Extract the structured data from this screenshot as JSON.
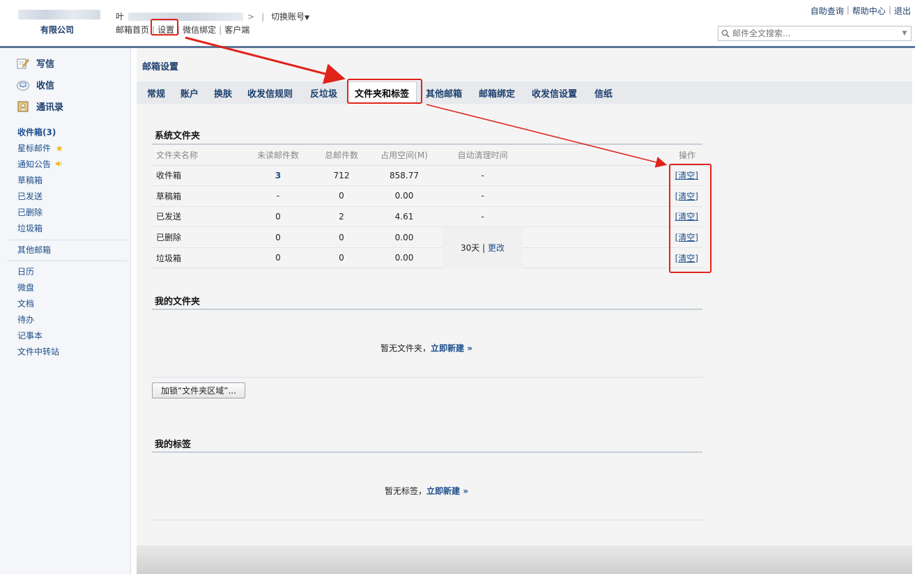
{
  "header": {
    "company": "有限公司",
    "account_prefix": "叶",
    "switch_account": "切换账号",
    "nav": [
      "邮箱首页",
      "设置",
      "微信绑定",
      "客户端"
    ],
    "top_links": [
      "自助查询",
      "帮助中心",
      "退出"
    ],
    "search_placeholder": "邮件全文搜索..."
  },
  "sidebar": {
    "compose": "写信",
    "receive": "收信",
    "contacts": "通讯录",
    "folders": [
      "收件箱(3)",
      "星标邮件",
      "通知公告",
      "草稿箱",
      "已发送",
      "已删除",
      "垃圾箱"
    ],
    "other_mailbox": "其他邮箱",
    "apps": [
      "日历",
      "微盘",
      "文档",
      "待办",
      "记事本",
      "文件中转站"
    ]
  },
  "main": {
    "title": "邮箱设置",
    "tabs": [
      "常规",
      "账户",
      "换肤",
      "收发信规则",
      "反垃圾",
      "文件夹和标签",
      "其他邮箱",
      "邮箱绑定",
      "收发信设置",
      "信纸"
    ],
    "system_folders": {
      "title": "系统文件夹",
      "columns": [
        "文件夹名称",
        "未读邮件数",
        "总邮件数",
        "占用空间(M)",
        "自动清理时间",
        "操作"
      ],
      "rows": [
        {
          "name": "收件箱",
          "unread": "3",
          "total": "712",
          "size": "858.77",
          "auto": "-",
          "op": "[清空]"
        },
        {
          "name": "草稿箱",
          "unread": "-",
          "total": "0",
          "size": "0.00",
          "auto": "-",
          "op": "[清空]"
        },
        {
          "name": "已发送",
          "unread": "0",
          "total": "2",
          "size": "4.61",
          "auto": "-",
          "op": "[清空]"
        },
        {
          "name": "已删除",
          "unread": "0",
          "total": "0",
          "size": "0.00",
          "op": "[清空]"
        },
        {
          "name": "垃圾箱",
          "unread": "0",
          "total": "0",
          "size": "0.00",
          "op": "[清空]"
        }
      ],
      "auto_clean": "30天",
      "change": "更改"
    },
    "my_folders": {
      "title": "我的文件夹",
      "empty": "暂无文件夹，",
      "create": "立即新建 »",
      "lock_button": "加锁“文件夹区域”..."
    },
    "my_tags": {
      "title": "我的标签",
      "empty": "暂无标签，",
      "create": "立即新建 »"
    }
  },
  "colors": {
    "link": "#1d4f8c",
    "header_line": "#5b7599",
    "annotation": "#e0231b"
  }
}
